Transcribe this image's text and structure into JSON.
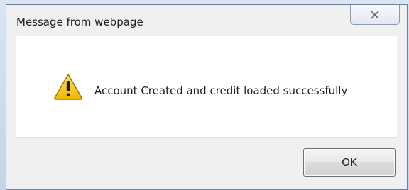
{
  "dialog": {
    "title": "Message from webpage",
    "close_icon": "close-x-icon",
    "icon": "warning-triangle-icon",
    "message": "Account Created and credit loaded successfully",
    "ok_label": "OK"
  },
  "colors": {
    "warning_fill": "#f5c400",
    "warning_outline": "#9a7a00",
    "button_border": "#707070",
    "dialog_border": "#6f8096"
  }
}
